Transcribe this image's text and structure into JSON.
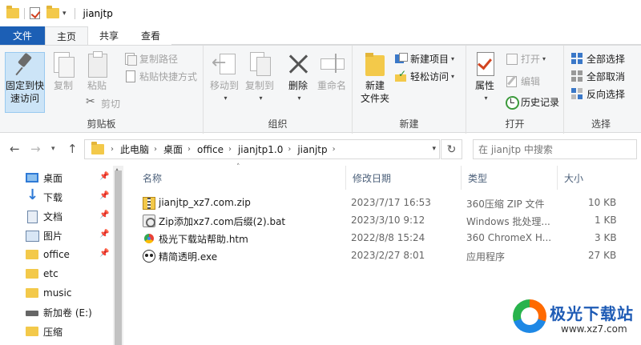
{
  "window": {
    "title": "jianjtp"
  },
  "tabs": [
    "文件",
    "主页",
    "共享",
    "查看"
  ],
  "ribbon": {
    "clipboard": {
      "label": "剪贴板",
      "pin_label_1": "固定到快",
      "pin_label_2": "速访问",
      "copy": "复制",
      "paste": "粘贴",
      "copy_path": "复制路径",
      "paste_shortcut": "粘贴快捷方式",
      "cut": "剪切"
    },
    "organize": {
      "label": "组织",
      "move_to": "移动到",
      "copy_to": "复制到",
      "delete": "删除",
      "rename": "重命名"
    },
    "new": {
      "label": "新建",
      "new_folder_1": "新建",
      "new_folder_2": "文件夹",
      "new_item": "新建项目",
      "easy_access": "轻松访问"
    },
    "open": {
      "label": "打开",
      "properties": "属性",
      "open": "打开",
      "edit": "编辑",
      "history": "历史记录"
    },
    "select": {
      "label": "选择",
      "select_all": "全部选择",
      "select_none": "全部取消",
      "invert": "反向选择"
    }
  },
  "address": {
    "crumbs": [
      "此电脑",
      "桌面",
      "office",
      "jianjtp1.0",
      "jianjtp"
    ],
    "search_placeholder": "在 jianjtp 中搜索"
  },
  "nav": [
    {
      "label": "桌面",
      "icon": "desktop-icon",
      "pinned": true
    },
    {
      "label": "下载",
      "icon": "download-icon",
      "pinned": true
    },
    {
      "label": "文档",
      "icon": "documents-icon",
      "pinned": true
    },
    {
      "label": "图片",
      "icon": "pictures-icon",
      "pinned": true
    },
    {
      "label": "office",
      "icon": "folder-icon",
      "pinned": true
    },
    {
      "label": "etc",
      "icon": "folder-icon",
      "pinned": false
    },
    {
      "label": "music",
      "icon": "folder-icon",
      "pinned": false
    },
    {
      "label": "新加卷 (E:)",
      "icon": "drive-icon",
      "pinned": false
    },
    {
      "label": "压缩",
      "icon": "folder-icon",
      "pinned": false
    }
  ],
  "columns": {
    "name": "名称",
    "date": "修改日期",
    "type": "类型",
    "size": "大小"
  },
  "files": [
    {
      "name": "jianjtp_xz7.com.zip",
      "date": "2023/7/17 16:53",
      "type": "360压缩 ZIP 文件",
      "size": "10 KB",
      "icon": "zip-icon"
    },
    {
      "name": "Zip添加xz7.com后缀(2).bat",
      "date": "2023/3/10 9:12",
      "type": "Windows 批处理...",
      "size": "1 KB",
      "icon": "bat-icon"
    },
    {
      "name": "极光下载站帮助.htm",
      "date": "2022/8/8 15:24",
      "type": "360 ChromeX H...",
      "size": "3 KB",
      "icon": "chrome-icon"
    },
    {
      "name": "精简透明.exe",
      "date": "2023/2/27 8:01",
      "type": "应用程序",
      "size": "27 KB",
      "icon": "exe-icon"
    }
  ],
  "watermark": {
    "name": "极光下载站",
    "url": "www.xz7.com"
  },
  "colors": {
    "file_tab": "#1c5fb5",
    "ribbon_bg": "#f5f6f7",
    "selected_btn": "#cce4f7"
  }
}
